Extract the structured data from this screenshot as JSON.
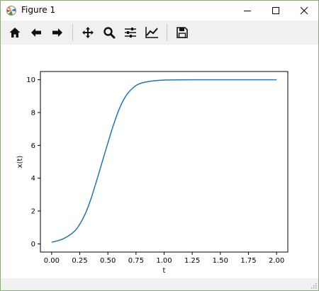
{
  "window": {
    "title": "Figure 1",
    "controls": {
      "minimize": "—",
      "maximize": "☐",
      "close": "✕"
    }
  },
  "toolbar": {
    "tools": [
      {
        "name": "home",
        "icon": "home-icon"
      },
      {
        "name": "back",
        "icon": "arrow-left-icon"
      },
      {
        "name": "forward",
        "icon": "arrow-right-icon"
      },
      {
        "name": "pan",
        "icon": "move-icon"
      },
      {
        "name": "zoom",
        "icon": "magnifier-icon"
      },
      {
        "name": "configure-subplots",
        "icon": "sliders-icon"
      },
      {
        "name": "edit-axis",
        "icon": "line-chart-icon"
      },
      {
        "name": "save",
        "icon": "floppy-disk-icon"
      }
    ]
  },
  "chart_data": {
    "type": "line",
    "title": "",
    "xlabel": "t",
    "ylabel": "x(t)",
    "xlim": [
      -0.1,
      2.1
    ],
    "ylim": [
      -0.5,
      10.5
    ],
    "xticks": [
      "0.00",
      "0.25",
      "0.50",
      "0.75",
      "1.00",
      "1.25",
      "1.50",
      "1.75",
      "2.00"
    ],
    "yticks": [
      "0",
      "2",
      "4",
      "6",
      "8",
      "10"
    ],
    "grid": false,
    "series": [
      {
        "color": "#1f77b4",
        "x": [
          0.0,
          0.1,
          0.2,
          0.25,
          0.3,
          0.35,
          0.4,
          0.45,
          0.5,
          0.55,
          0.6,
          0.65,
          0.7,
          0.75,
          0.8,
          0.9,
          1.0,
          1.1,
          1.25,
          1.5,
          1.75,
          2.0
        ],
        "y": [
          0.1,
          0.3,
          0.75,
          1.2,
          1.85,
          2.75,
          3.85,
          5.0,
          6.15,
          7.25,
          8.2,
          8.9,
          9.35,
          9.65,
          9.8,
          9.93,
          9.98,
          9.99,
          10.0,
          10.0,
          10.0,
          10.0
        ]
      }
    ]
  }
}
